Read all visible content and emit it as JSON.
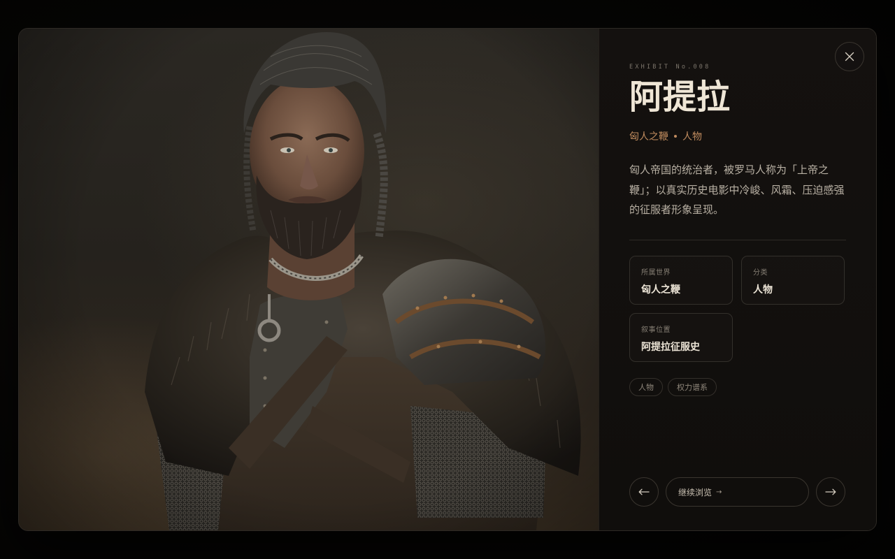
{
  "exhibit": {
    "eyebrow": "EXHIBIT No.008",
    "title": "阿提拉",
    "world": "匈人之鞭",
    "category": "人物",
    "description": "匈人帝国的统治者，被罗马人称为「上帝之鞭」；以真实历史电影中冷峻、风霜、压迫感强的征服者形象呈现。"
  },
  "image": {
    "subject": "bearded-warrior-portrait"
  },
  "info_cards": [
    {
      "label": "所属世界",
      "value": "匈人之鞭"
    },
    {
      "label": "分类",
      "value": "人物"
    },
    {
      "label": "叙事位置",
      "value": "阿提拉征服史"
    }
  ],
  "tags": [
    "人物",
    "权力谱系"
  ],
  "controls": {
    "close_icon": "close-icon",
    "prev_icon": "arrow-left-icon",
    "next_icon": "arrow-right-icon",
    "continue_label": "继续浏览",
    "continue_arrow": "→"
  },
  "colors": {
    "accent": "#c08b5e",
    "title": "#efe6d6",
    "panel_bg": "#100e0c",
    "border": "#33302b"
  }
}
